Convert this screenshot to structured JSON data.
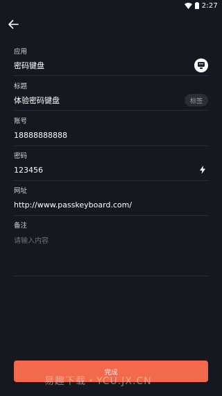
{
  "status_bar": {
    "time": "2:27"
  },
  "form": {
    "app": {
      "label": "应用",
      "value": "密码键盘"
    },
    "title": {
      "label": "标题",
      "value": "体验密码键盘",
      "tag_button": "标签"
    },
    "account": {
      "label": "账号",
      "value": "18888888888"
    },
    "password": {
      "label": "密码",
      "value": "123456"
    },
    "url": {
      "label": "网址",
      "value": "http://www.passkeyboard.com/"
    },
    "note": {
      "label": "备注",
      "placeholder": "请输入内容"
    }
  },
  "done_button": {
    "label": "完成"
  },
  "watermark": "易趣下载・YCU.JX.CN",
  "colors": {
    "background": "#161821",
    "accent": "#f2694c",
    "divider": "#2e3039"
  },
  "icons": [
    "wifi-icon",
    "battery-icon",
    "back-arrow-icon",
    "app-icon",
    "lightning-icon"
  ]
}
